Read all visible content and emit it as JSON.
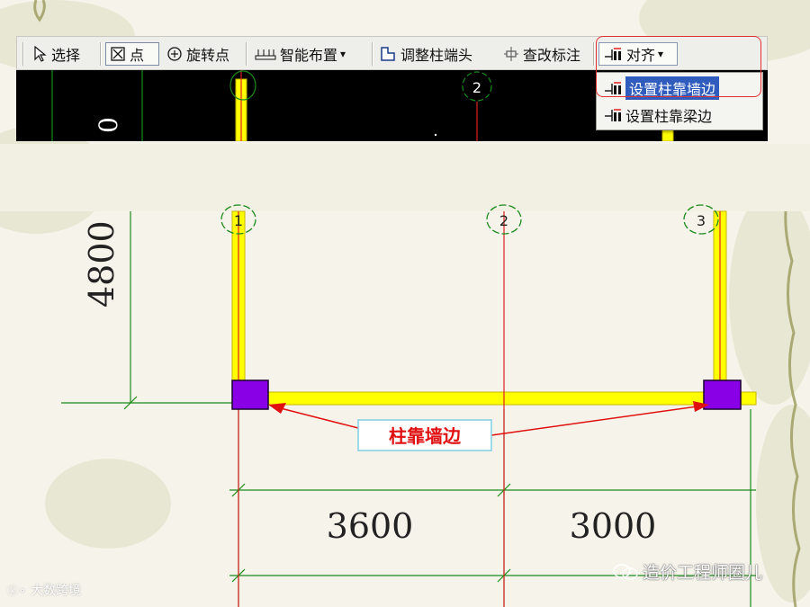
{
  "toolbar": {
    "items": [
      {
        "label": "选择",
        "icon": "cursor-arrow-icon"
      },
      {
        "label": "点",
        "icon": "boxed-x-point-icon"
      },
      {
        "label": "旋转点",
        "icon": "rotate-point-icon"
      },
      {
        "label": "智能布置",
        "icon": "smart-layout-icon",
        "has_dropdown": true
      },
      {
        "label": "调整柱端头",
        "icon": "adjust-column-end-icon"
      },
      {
        "label": "查改标注",
        "icon": "dimension-edit-icon"
      },
      {
        "label": "对齐",
        "icon": "align-columns-icon",
        "has_dropdown": true
      }
    ],
    "dropdown_arrow": "▾"
  },
  "align_menu": {
    "items": [
      {
        "label": "设置柱靠墙边",
        "icon": "column-wall-align-icon",
        "highlighted": true
      },
      {
        "label": "设置柱靠梁边",
        "icon": "column-beam-align-icon",
        "highlighted": false
      }
    ]
  },
  "canvas_strip": {
    "axis_bubble_label": "2"
  },
  "drawing": {
    "axes": [
      "1",
      "2",
      "3"
    ],
    "vertical_dimension": "4800",
    "horizontal_dimensions": [
      "3600",
      "3000"
    ],
    "callout_label": "柱靠墙边",
    "colors": {
      "wall": "#ffff00",
      "wall_edge": "#c8b400",
      "column": "#8a00e6",
      "axis": "#e02020",
      "dimension": "#1a8a1a",
      "callout": "#e01010",
      "callout_box": "#7fd0e0"
    }
  },
  "watermarks": {
    "left": "大数跨境",
    "right": "造价工程师圈儿"
  }
}
